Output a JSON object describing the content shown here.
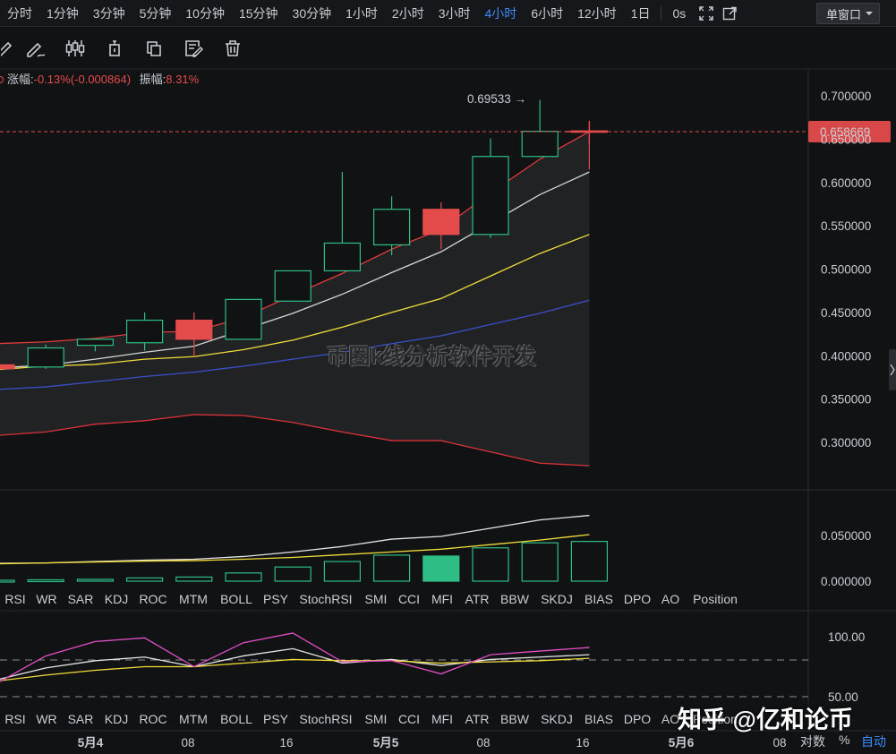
{
  "intervals": [
    "分时",
    "1分钟",
    "3分钟",
    "5分钟",
    "10分钟",
    "15分钟",
    "30分钟",
    "1小时",
    "2小时",
    "3小时",
    "4小时",
    "6小时",
    "12小时",
    "1日",
    "0s"
  ],
  "active_interval": "4小时",
  "window_select": "单窗口",
  "info": {
    "change_label": "涨幅:",
    "change_value": "-0.13%(-0.000864)",
    "amplitude_label": "振幅:",
    "amplitude_value": "8.31%"
  },
  "watermark": "币圈k线分析软件开发",
  "source_mark": "知乎 @亿和论币",
  "current_price": "0.658669",
  "high_label": "0.69533 →",
  "price_axis": [
    "0.700000",
    "0.650000",
    "0.600000",
    "0.550000",
    "0.500000",
    "0.450000",
    "0.400000",
    "0.350000",
    "0.300000"
  ],
  "sub1_axis": [
    "0.050000",
    "0.000000"
  ],
  "sub2_axis": [
    "100.00",
    "50.00"
  ],
  "indicator_tabs_1": [
    "RSI",
    "WR",
    "SAR",
    "KDJ",
    "ROC",
    "MTM",
    "BOLL",
    "PSY",
    "StochRSI",
    "SMI",
    "CCI",
    "MFI",
    "ATR",
    "BBW",
    "SKDJ",
    "BIAS",
    "DPO",
    "AO",
    "Position"
  ],
  "indicator_tabs_2": [
    "RSI",
    "WR",
    "SAR",
    "KDJ",
    "ROC",
    "MTM",
    "BOLL",
    "PSY",
    "StochRSI",
    "SMI",
    "CCI",
    "MFI",
    "ATR",
    "BBW",
    "SKDJ",
    "BIAS",
    "DPO",
    "AO",
    "Position"
  ],
  "time_axis": [
    "5月4",
    "08",
    "16",
    "5月5",
    "08",
    "16",
    "5月6",
    "08"
  ],
  "bottom_controls": {
    "log_label": "对数",
    "percent_label": "%",
    "auto_label": "自动"
  },
  "colors": {
    "up": "#2ebd85",
    "down": "#e44b4b",
    "accent": "#3d8bff"
  },
  "chart_data": {
    "type": "candlestick",
    "candles": [
      {
        "o": 0.3895,
        "h": 0.3905,
        "l": 0.385,
        "c": 0.385
      },
      {
        "o": 0.387,
        "h": 0.413,
        "l": 0.385,
        "c": 0.409
      },
      {
        "o": 0.412,
        "h": 0.42,
        "l": 0.405,
        "c": 0.419
      },
      {
        "o": 0.415,
        "h": 0.45,
        "l": 0.406,
        "c": 0.441
      },
      {
        "o": 0.441,
        "h": 0.45,
        "l": 0.399,
        "c": 0.419
      },
      {
        "o": 0.419,
        "h": 0.465,
        "l": 0.419,
        "c": 0.465
      },
      {
        "o": 0.463,
        "h": 0.498,
        "l": 0.463,
        "c": 0.498
      },
      {
        "o": 0.498,
        "h": 0.612,
        "l": 0.498,
        "c": 0.53
      },
      {
        "o": 0.528,
        "h": 0.584,
        "l": 0.516,
        "c": 0.569
      },
      {
        "o": 0.569,
        "h": 0.577,
        "l": 0.523,
        "c": 0.54
      },
      {
        "o": 0.54,
        "h": 0.651,
        "l": 0.536,
        "c": 0.63
      },
      {
        "o": 0.63,
        "h": 0.6953,
        "l": 0.63,
        "c": 0.659
      },
      {
        "o": 0.6595,
        "h": 0.67,
        "l": 0.615,
        "c": 0.6587
      }
    ],
    "boll_upper": [
      0.414,
      0.416,
      0.42,
      0.427,
      0.428,
      0.444,
      0.47,
      0.495,
      0.523,
      0.546,
      0.588,
      0.627,
      0.6587
    ],
    "boll_mid": [
      0.386,
      0.389,
      0.396,
      0.404,
      0.411,
      0.43,
      0.449,
      0.471,
      0.496,
      0.52,
      0.553,
      0.586,
      0.612
    ],
    "ma_yellow": [
      0.384,
      0.388,
      0.39,
      0.396,
      0.399,
      0.407,
      0.418,
      0.433,
      0.45,
      0.466,
      0.492,
      0.518,
      0.54
    ],
    "ma_blue": [
      0.361,
      0.364,
      0.37,
      0.376,
      0.381,
      0.388,
      0.396,
      0.404,
      0.414,
      0.423,
      0.436,
      0.449,
      0.464
    ],
    "boll_lower": [
      0.308,
      0.312,
      0.321,
      0.325,
      0.332,
      0.331,
      0.323,
      0.312,
      0.302,
      0.302,
      0.289,
      0.276,
      0.273
    ],
    "sub1_hist": [
      0.001,
      0.0015,
      0.002,
      0.0035,
      0.0045,
      0.009,
      0.0155,
      0.0215,
      0.0285,
      0.0275,
      0.0365,
      0.042,
      0.0435
    ],
    "sub1_hist_colors": [
      "up",
      "up",
      "up",
      "up",
      "up",
      "up",
      "up",
      "up",
      "up",
      "solid",
      "up",
      "up",
      "up"
    ],
    "sub1_white": [
      0.0195,
      0.02,
      0.0215,
      0.023,
      0.024,
      0.027,
      0.032,
      0.038,
      0.046,
      0.049,
      0.058,
      0.067,
      0.072
    ],
    "sub1_yellow": [
      0.019,
      0.02,
      0.021,
      0.022,
      0.0225,
      0.024,
      0.026,
      0.029,
      0.032,
      0.035,
      0.04,
      0.045,
      0.051
    ],
    "sub2_pink": [
      61,
      84,
      96,
      99,
      75,
      95,
      103,
      79,
      80,
      69,
      85,
      88,
      91
    ],
    "sub2_white": [
      64,
      74,
      80,
      83,
      75,
      84,
      90,
      78,
      81,
      76,
      81,
      83,
      85
    ],
    "sub2_yellow": [
      63,
      68,
      72,
      75,
      75,
      78,
      81,
      80,
      80,
      78,
      79,
      80,
      82
    ]
  }
}
